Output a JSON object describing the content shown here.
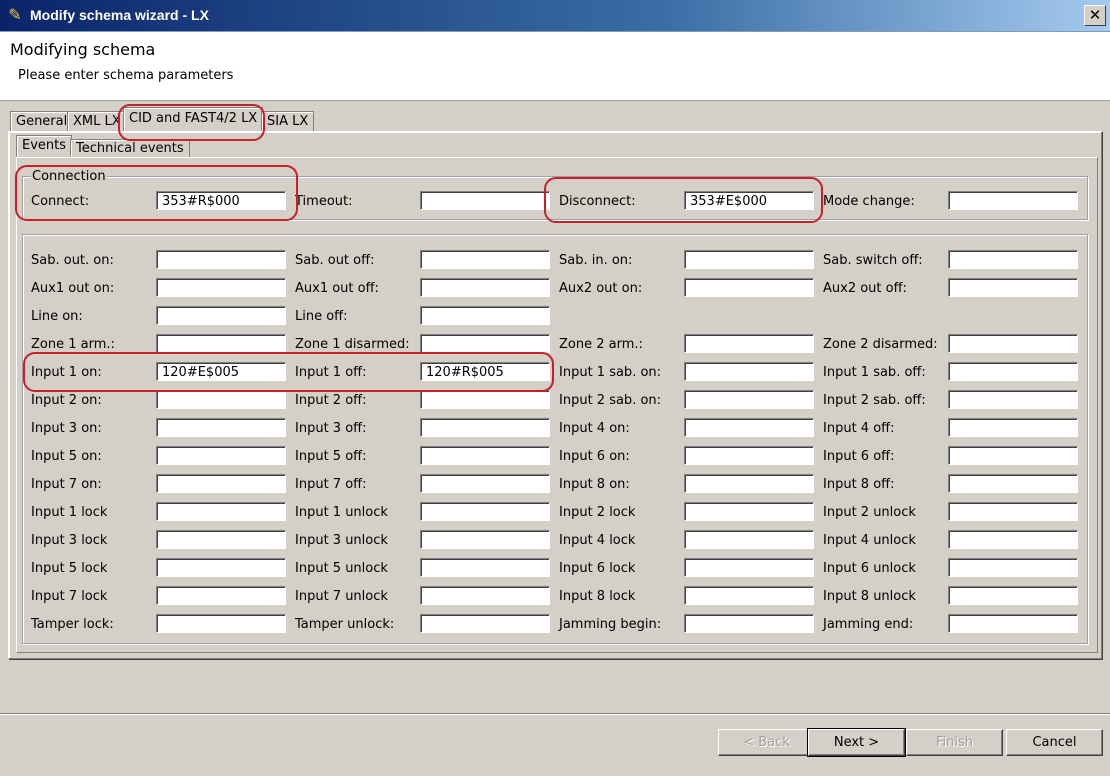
{
  "window": {
    "title": "Modify schema wizard - LX",
    "close_symbol": "✕"
  },
  "header": {
    "title": "Modifying schema",
    "subtitle": "Please enter schema parameters"
  },
  "tabs": [
    "General",
    "XML LX",
    "CID and FAST4/2 LX",
    "SIA LX"
  ],
  "subtabs": [
    "Events",
    "Technical events"
  ],
  "connection": {
    "legend": "Connection",
    "fields": [
      {
        "label": "Connect:",
        "value": "353#R$000"
      },
      {
        "label": "Timeout:",
        "value": ""
      },
      {
        "label": "Disconnect:",
        "value": "353#E$000"
      },
      {
        "label": "Mode change:",
        "value": ""
      }
    ]
  },
  "events": [
    [
      {
        "label": "Sab. out. on:",
        "value": ""
      },
      {
        "label": "Sab. out off:",
        "value": ""
      },
      {
        "label": "Sab. in. on:",
        "value": ""
      },
      {
        "label": "Sab. switch off:",
        "value": ""
      }
    ],
    [
      {
        "label": "Aux1 out on:",
        "value": ""
      },
      {
        "label": "Aux1 out off:",
        "value": ""
      },
      {
        "label": "Aux2 out on:",
        "value": ""
      },
      {
        "label": "Aux2 out off:",
        "value": ""
      }
    ],
    [
      {
        "label": "Line on:",
        "value": ""
      },
      {
        "label": "Line off:",
        "value": ""
      }
    ],
    [
      {
        "label": "Zone 1 arm.:",
        "value": ""
      },
      {
        "label": "Zone 1 disarmed:",
        "value": ""
      },
      {
        "label": "Zone 2 arm.:",
        "value": ""
      },
      {
        "label": "Zone 2 disarmed:",
        "value": ""
      }
    ],
    [
      {
        "label": "Input 1 on:",
        "value": "120#E$005"
      },
      {
        "label": "Input 1 off:",
        "value": "120#R$005"
      },
      {
        "label": "Input 1 sab. on:",
        "value": ""
      },
      {
        "label": "Input 1 sab. off:",
        "value": ""
      }
    ],
    [
      {
        "label": "Input 2 on:",
        "value": ""
      },
      {
        "label": "Input 2 off:",
        "value": ""
      },
      {
        "label": "Input 2 sab. on:",
        "value": ""
      },
      {
        "label": "Input 2 sab. off:",
        "value": ""
      }
    ],
    [
      {
        "label": "Input 3 on:",
        "value": ""
      },
      {
        "label": "Input 3 off:",
        "value": ""
      },
      {
        "label": "Input 4 on:",
        "value": ""
      },
      {
        "label": "Input 4 off:",
        "value": ""
      }
    ],
    [
      {
        "label": "Input 5 on:",
        "value": ""
      },
      {
        "label": "Input 5 off:",
        "value": ""
      },
      {
        "label": "Input 6 on:",
        "value": ""
      },
      {
        "label": "Input 6 off:",
        "value": ""
      }
    ],
    [
      {
        "label": "Input 7 on:",
        "value": ""
      },
      {
        "label": "Input 7 off:",
        "value": ""
      },
      {
        "label": "Input 8 on:",
        "value": ""
      },
      {
        "label": "Input 8 off:",
        "value": ""
      }
    ],
    [
      {
        "label": "Input 1 lock",
        "value": ""
      },
      {
        "label": "Input 1 unlock",
        "value": ""
      },
      {
        "label": "Input 2 lock",
        "value": ""
      },
      {
        "label": "Input 2 unlock",
        "value": ""
      }
    ],
    [
      {
        "label": "Input 3 lock",
        "value": ""
      },
      {
        "label": "Input 3 unlock",
        "value": ""
      },
      {
        "label": "Input 4 lock",
        "value": ""
      },
      {
        "label": "Input 4 unlock",
        "value": ""
      }
    ],
    [
      {
        "label": "Input 5 lock",
        "value": ""
      },
      {
        "label": "Input 5 unlock",
        "value": ""
      },
      {
        "label": "Input 6 lock",
        "value": ""
      },
      {
        "label": "Input 6 unlock",
        "value": ""
      }
    ],
    [
      {
        "label": "Input 7 lock",
        "value": ""
      },
      {
        "label": "Input 7 unlock",
        "value": ""
      },
      {
        "label": "Input 8 lock",
        "value": ""
      },
      {
        "label": "Input 8 unlock",
        "value": ""
      }
    ],
    [
      {
        "label": "Tamper lock:",
        "value": ""
      },
      {
        "label": "Tamper unlock:",
        "value": ""
      },
      {
        "label": "Jamming begin:",
        "value": ""
      },
      {
        "label": "Jamming end:",
        "value": ""
      }
    ]
  ],
  "buttons": {
    "back": "< Back",
    "next": "Next >",
    "finish": "Finish",
    "cancel": "Cancel"
  },
  "colors": {
    "highlight": "#c8202a",
    "titlebar_start": "#0a246a",
    "titlebar_end": "#a6caf0"
  }
}
